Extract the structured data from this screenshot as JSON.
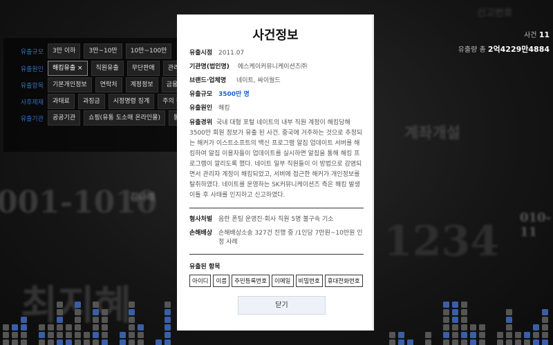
{
  "background": {
    "filter_rows": [
      {
        "label": "유출규모",
        "chips": [
          "3만 이하",
          "3만~10만",
          "10만~100만"
        ]
      },
      {
        "label": "유출원인",
        "chips": [
          "해킹유출 ×",
          "직원유출",
          "무단판매",
          "관리소홀"
        ]
      },
      {
        "label": "유출항목",
        "chips": [
          "기본개인정보",
          "연락처",
          "계정정보",
          "금융정보"
        ]
      },
      {
        "label": "사후제재",
        "chips": [
          "과태료",
          "과징금",
          "시정명령 징계",
          "주의 경고"
        ]
      },
      {
        "label": "유출기관",
        "chips": [
          "공공기관",
          "쇼핑(유통 도소매 온라인몰)",
          "통신"
        ]
      }
    ],
    "stats": {
      "cases_label": "사건",
      "cases_value": "11",
      "total_label": "유출량 총",
      "total_value": "2억4229만4884"
    },
    "overlay_texts": [
      "001-1010",
      "010-11",
      "최지혜",
      "김나래",
      "계좌개설",
      "1234",
      "신고번호"
    ]
  },
  "modal": {
    "title": "사건정보",
    "fields": [
      {
        "key": "유출시점",
        "value": "2011.07"
      },
      {
        "key": "기관명(법인명)",
        "value": "에스케이커뮤니케이션즈㈜"
      },
      {
        "key": "브랜드·업체명",
        "value": "네이트, 싸이월드"
      },
      {
        "key": "유출규모",
        "value": "3500만 명"
      },
      {
        "key": "유출원인",
        "value": "해킹"
      }
    ],
    "history_key": "유출경위",
    "history": "국내 대형 포털 네이트의 내부 직원 계정이 해킹당해 3500만 회원 정보가 유출 된 사건. 중국에 거주하는 것으로 추정되는 해커가 이스트소프트의 백신 프로그램 알집 업데이트 서버를 해킹하여 알집 이용자들이 업데이트를 실시하면 알집을 통해 해킹 프로그램이 깔리도록 했다. 네이트 일부 직원들이 이 방법으로 감염되면서 관리자 계정이 해킹되었고, 서버에 접근한 해커가 개인정보를 탈취하였다. 네이트를 운영하는 SK커뮤니케이션즈 측은 해킹 발생 이틀 후 사태를 인지하고 신고하였다.",
    "criminal_key": "형사처벌",
    "criminal": "음란 폰팅 운영진·회사 직원 5명 불구속 기소",
    "damages_key": "손해배상",
    "damages": "손해배상소송 327건 진행 중 /1인당 7만원~10만원 인정 사례",
    "items_label": "유출된 항목",
    "items": [
      "아이디",
      "이름",
      "주민등록번호",
      "이메일",
      "비밀번호",
      "휴대전화번호"
    ],
    "close_label": "닫기"
  },
  "colors": {
    "accent": "#1a5fd0",
    "label_blue": "#2f6fc0"
  }
}
